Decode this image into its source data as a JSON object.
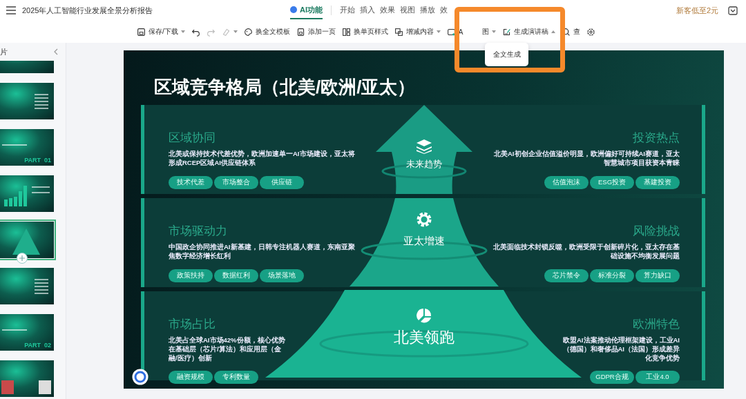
{
  "app": {
    "title": "2025年人工智能行业发展全景分析报告",
    "promo": "新客低至2元"
  },
  "menu_tabs": [
    {
      "label": "AI功能",
      "selected": true,
      "kind": "ai"
    },
    {
      "label": "开始",
      "selected": false,
      "kind": "plain"
    },
    {
      "label": "插入",
      "selected": false,
      "kind": "plain"
    },
    {
      "label": "效果",
      "selected": false,
      "kind": "plain"
    },
    {
      "label": "视图",
      "selected": false,
      "kind": "plain"
    },
    {
      "label": "播放",
      "selected": false,
      "kind": "plain"
    },
    {
      "label": "效",
      "selected": false,
      "kind": "plain"
    }
  ],
  "toolbar": [
    {
      "kind": "save",
      "label": "保存/下载",
      "expanded": false,
      "disabled": false
    },
    {
      "kind": "undo",
      "disabled": false
    },
    {
      "kind": "redo",
      "disabled": true
    },
    {
      "kind": "brush",
      "expanded": false,
      "disabled": true
    },
    {
      "kind": "palette",
      "label": "换全文模板",
      "disabled": false
    },
    {
      "kind": "add-page",
      "label": "添加一页",
      "disabled": false
    },
    {
      "kind": "layout",
      "label": "换单页样式",
      "disabled": false
    },
    {
      "kind": "content",
      "label": "增减内容",
      "expanded": false,
      "disabled": false
    },
    {
      "kind": "image",
      "label_parts": [
        "A",
        "图"
      ],
      "expanded": false,
      "disabled": false
    },
    {
      "kind": "script",
      "label": "生成演讲稿",
      "expanded": true,
      "disabled": false
    },
    {
      "kind": "search",
      "label": "查",
      "disabled": false
    },
    {
      "kind": "settings",
      "disabled": false
    }
  ],
  "dropdown_menu": {
    "items": [
      "全文生成"
    ]
  },
  "annotation": {
    "kind": "highlight-frame",
    "color": "#f5892b"
  },
  "sidebar": {
    "header": "片",
    "thumbnails": [
      {
        "kind": "cover",
        "selected": false
      },
      {
        "kind": "list",
        "selected": false
      },
      {
        "kind": "part",
        "label": "PART  01",
        "selected": false
      },
      {
        "kind": "chart",
        "selected": false
      },
      {
        "kind": "pyramid",
        "selected": true
      },
      {
        "kind": "list",
        "selected": false
      },
      {
        "kind": "part",
        "label": "PART  02",
        "selected": false
      },
      {
        "kind": "photo",
        "selected": false
      }
    ]
  },
  "slide": {
    "title": "区域竞争格局（北美/欧洲/亚太）",
    "pyramid_levels": [
      {
        "label": "未来趋势"
      },
      {
        "label": "亚太增速"
      },
      {
        "label": "北美领跑"
      }
    ],
    "bands": [
      {
        "left": {
          "title": "区域协同",
          "text": "北美或保持技术代差优势，欧洲加速单一AI市场建设，亚太将形成RCEP区域AI供应链体系",
          "tags": [
            "技术代差",
            "市场整合",
            "供应链"
          ]
        },
        "right": {
          "title": "投资热点",
          "text": "北美AI初创企业估值溢价明显，欧洲偏好可持续AI赛道，亚太智慧城市项目获资本青睐",
          "tags": [
            "估值泡沫",
            "ESG投资",
            "基建投资"
          ]
        }
      },
      {
        "left": {
          "title": "市场驱动力",
          "text": "中国政企协同推进AI新基建，日韩专注机器人赛道，东南亚聚焦数字经济增长红利",
          "tags": [
            "政策扶持",
            "数据红利",
            "场景落地"
          ]
        },
        "right": {
          "title": "风险挑战",
          "text": "北美面临技术封锁反噬，欧洲受限于创新碎片化，亚太存在基础设施不均衡发展问题",
          "tags": [
            "芯片禁令",
            "标准分裂",
            "算力缺口"
          ]
        }
      },
      {
        "left": {
          "title": "市场占比",
          "text": "北美占全球AI市场42%份额，核心优势在基础层（芯片/算法）和应用层（金融/医疗）创新",
          "tags": [
            "融资规模",
            "专利数量"
          ]
        },
        "right": {
          "title": "欧洲特色",
          "text": "欧盟AI法案推动伦理框架建设，工业AI（德国）和奢侈品AI（法国）形成差异化竞争优势",
          "tags": [
            "GDPR合规",
            "工业4.0"
          ]
        }
      }
    ]
  }
}
